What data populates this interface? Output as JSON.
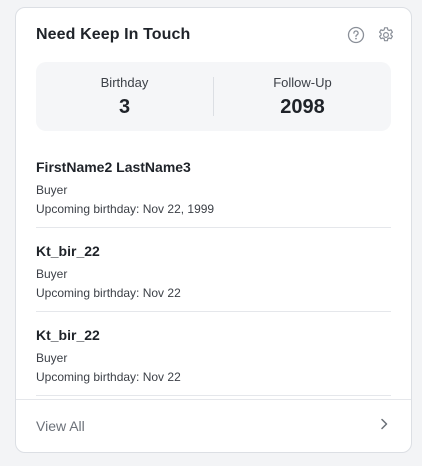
{
  "card": {
    "title": "Need Keep In Touch",
    "icons": [
      "help-circle-icon",
      "gear-icon"
    ]
  },
  "stats": [
    {
      "label": "Birthday",
      "value": "3"
    },
    {
      "label": "Follow-Up",
      "value": "2098"
    }
  ],
  "contacts": [
    {
      "name": "FirstName2 LastName3",
      "role": "Buyer",
      "birthday": "Upcoming birthday: Nov 22, 1999"
    },
    {
      "name": "Kt_bir_22",
      "role": "Buyer",
      "birthday": "Upcoming birthday: Nov 22"
    },
    {
      "name": "Kt_bir_22",
      "role": "Buyer",
      "birthday": "Upcoming birthday: Nov 22"
    }
  ],
  "footer": {
    "label": "View All",
    "icon": "chevron-right-icon"
  },
  "colors": {
    "background": "#f3f4f6",
    "card": "#ffffff",
    "stats_bg": "#f5f6f8",
    "text": "#1f2329",
    "muted": "#6b7078",
    "border": "#e5e7eb"
  }
}
